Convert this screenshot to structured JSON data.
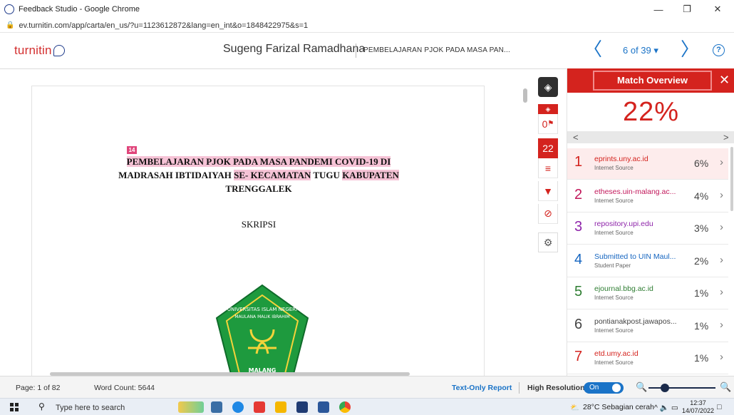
{
  "window": {
    "title": "Feedback Studio - Google Chrome",
    "minimize_icon": "minimize-icon",
    "restore_icon": "restore-icon",
    "close_icon": "close-icon"
  },
  "address": {
    "url": "ev.turnitin.com/app/carta/en_us/?u=1123612872&lang=en_int&o=1848422975&s=1"
  },
  "header": {
    "logo_text": "turnitin",
    "author": "Sugeng Farizal Ramadhana",
    "doc_title": "PEMBELAJARAN PJOK PADA MASA PAN...",
    "page_count": "6 of 39 ▾",
    "prev_glyph": "〈",
    "next_glyph": "〉",
    "help_glyph": "?"
  },
  "document": {
    "marker": "14",
    "title_line1": "PEMBELAJARAN PJOK PADA MASA PANDEMI COVID-19 DI",
    "title_line2_a": "MADRASAH IBTIDAIYAH ",
    "title_line2_b": "SE- KECAMATAN",
    "title_line2_c": " TUGU ",
    "title_line2_d": "KABUPATEN",
    "title_line3": "TRENGGALEK",
    "subtitle": "SKRIPSI",
    "seal_text_top": "UNIVERSITAS ISLAM NEGERI",
    "seal_text_mid": "MAULANA MALIK IBRAHIM",
    "seal_text_bottom": "MALANG"
  },
  "tools": {
    "flag_count": "0",
    "match_count": "22"
  },
  "match_overview": {
    "title": "Match Overview",
    "close_glyph": "✕",
    "score": "22%",
    "prev_glyph": "<",
    "next_glyph": ">",
    "matches": [
      {
        "num": "1",
        "source": "eprints.uny.ac.id",
        "type": "Internet Source",
        "pct": "6%",
        "color": "#d4231e"
      },
      {
        "num": "2",
        "source": "etheses.uin-malang.ac...",
        "type": "Internet Source",
        "pct": "4%",
        "color": "#c2185b"
      },
      {
        "num": "3",
        "source": "repository.upi.edu",
        "type": "Internet Source",
        "pct": "3%",
        "color": "#8e24aa"
      },
      {
        "num": "4",
        "source": "Submitted to UIN Maul...",
        "type": "Student Paper",
        "pct": "2%",
        "color": "#1565c0"
      },
      {
        "num": "5",
        "source": "ejournal.bbg.ac.id",
        "type": "Internet Source",
        "pct": "1%",
        "color": "#2e7d32"
      },
      {
        "num": "6",
        "source": "pontianakpost.jawapos...",
        "type": "Internet Source",
        "pct": "1%",
        "color": "#444444"
      },
      {
        "num": "7",
        "source": "etd.umy.ac.id",
        "type": "Internet Source",
        "pct": "1%",
        "color": "#d4231e"
      }
    ]
  },
  "status": {
    "page": "Page: 1 of 82",
    "word_count": "Word Count: 5644",
    "text_only": "Text-Only Report",
    "high_res": "High Resolution",
    "toggle_label": "On",
    "zoom_out_glyph": "🔍",
    "zoom_in_glyph": "🔍"
  },
  "taskbar": {
    "search_placeholder": "Type here to search",
    "weather": "28°C  Sebagian cerah",
    "tray_icons": "^  🔈  ▭",
    "time": "12:37",
    "date": "14/07/2022"
  },
  "colors": {
    "accent_red": "#d4231e",
    "link_blue": "#1a73c7",
    "highlight_pink": "#f6c3d6"
  }
}
